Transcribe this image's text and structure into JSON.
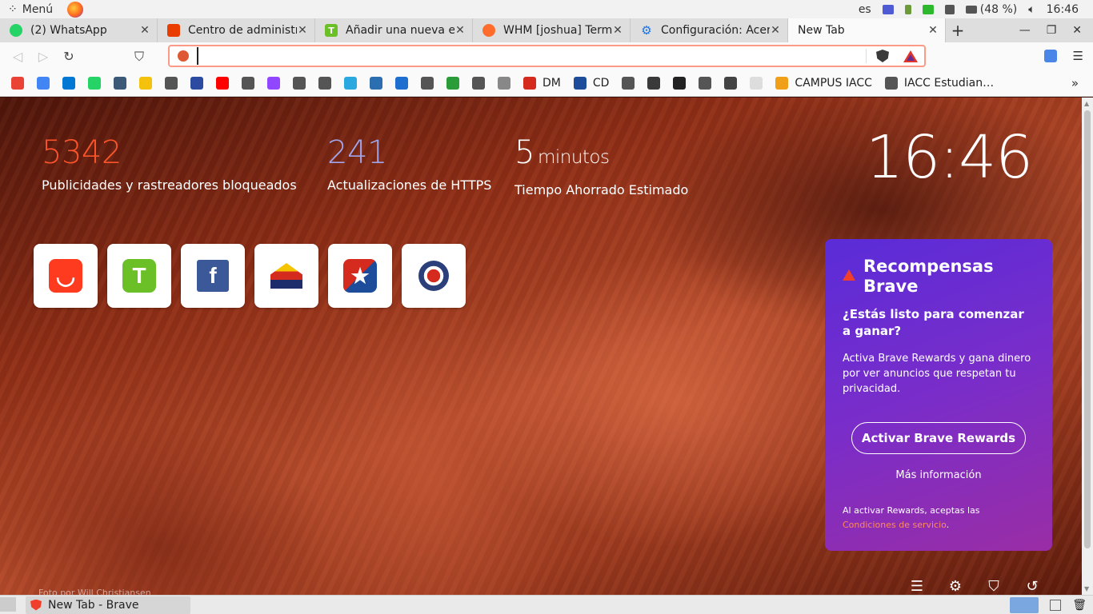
{
  "system": {
    "menu_label": "Menú",
    "lang": "es",
    "battery": "(48 %)",
    "time": "16:46"
  },
  "tabs": [
    {
      "title": "(2) WhatsApp",
      "icon": "whatsapp-icon",
      "color": "#25d366"
    },
    {
      "title": "Centro de administra",
      "icon": "office-icon",
      "color": "#eb3c00"
    },
    {
      "title": "Añadir una nueva en",
      "icon": "t-icon",
      "color": "#6bbf27"
    },
    {
      "title": "WHM [joshua] Termi",
      "icon": "cpanel-icon",
      "color": "#ff6c2c"
    },
    {
      "title": "Configuración: Acer",
      "icon": "gear-icon",
      "color": "#1a73e8"
    },
    {
      "title": "New Tab",
      "icon": "",
      "color": ""
    }
  ],
  "toolbar": {
    "url_value": "",
    "url_placeholder": ""
  },
  "bookmarks": [
    {
      "label": "",
      "color": "#ea4335"
    },
    {
      "label": "",
      "color": "#4285f4"
    },
    {
      "label": "",
      "color": "#0078d4"
    },
    {
      "label": "",
      "color": "#25d366"
    },
    {
      "label": "",
      "color": "#3c5a78"
    },
    {
      "label": "",
      "color": "#f4c20d"
    },
    {
      "label": "",
      "color": "#555555"
    },
    {
      "label": "",
      "color": "#2b4aa0"
    },
    {
      "label": "",
      "color": "#ff0000"
    },
    {
      "label": "",
      "color": "#555555"
    },
    {
      "label": "",
      "color": "#9146ff"
    },
    {
      "label": "",
      "color": "#555555"
    },
    {
      "label": "",
      "color": "#555555"
    },
    {
      "label": "",
      "color": "#2aa8e0"
    },
    {
      "label": "",
      "color": "#2b6fb0"
    },
    {
      "label": "",
      "color": "#1e6fd0"
    },
    {
      "label": "",
      "color": "#555555"
    },
    {
      "label": "",
      "color": "#2a9d3a"
    },
    {
      "label": "",
      "color": "#555555"
    },
    {
      "label": "",
      "color": "#888888"
    },
    {
      "label": "DM",
      "color": "#d52b1e"
    },
    {
      "label": "CD",
      "color": "#1d4d9a"
    },
    {
      "label": "",
      "color": "#555555"
    },
    {
      "label": "",
      "color": "#3a3a3a"
    },
    {
      "label": "",
      "color": "#222222"
    },
    {
      "label": "",
      "color": "#555555"
    },
    {
      "label": "",
      "color": "#444444"
    },
    {
      "label": "",
      "color": "#dddddd"
    },
    {
      "label": "CAMPUS IACC",
      "color": "#f0a018"
    },
    {
      "label": "IACC Estudian…",
      "color": "#555555"
    }
  ],
  "stats": {
    "ads_blocked": "5342",
    "ads_label": "Publicidades y rastreadores bloqueados",
    "https_upgrades": "241",
    "https_label": "Actualizaciones de HTTPS",
    "time_saved": "5",
    "time_unit": "minutos",
    "time_label": "Tiempo Ahorrado Estimado"
  },
  "clock": "16:46",
  "top_sites": [
    {
      "name": "aliexpress-tile",
      "color": "#ff3b1f",
      "glyph": "◡"
    },
    {
      "name": "t-tile",
      "color": "#6bbf27",
      "glyph": "T"
    },
    {
      "name": "facebook-tile",
      "color": "#3b5998",
      "glyph": "f"
    },
    {
      "name": "house-tile",
      "color": "#1d2c6b",
      "glyph": "⌂"
    },
    {
      "name": "star-tile",
      "color": "#d52b1e",
      "glyph": "★"
    },
    {
      "name": "seal-tile",
      "color": "#2b3f7a",
      "glyph": "●"
    }
  ],
  "rewards": {
    "title": "Recompensas Brave",
    "question": "¿Estás listo para comenzar a ganar?",
    "description": "Activa Brave Rewards y gana dinero por ver anuncios que respetan tu privacidad.",
    "button": "Activar Brave Rewards",
    "more_info": "Más información",
    "tos_prefix": "Al activar Rewards, aceptas las",
    "tos_link": "Condiciones de servicio",
    "tos_suffix": "."
  },
  "photo_credit": "Foto por Will Christiansen",
  "taskbar": {
    "window_title": "New Tab - Brave"
  }
}
